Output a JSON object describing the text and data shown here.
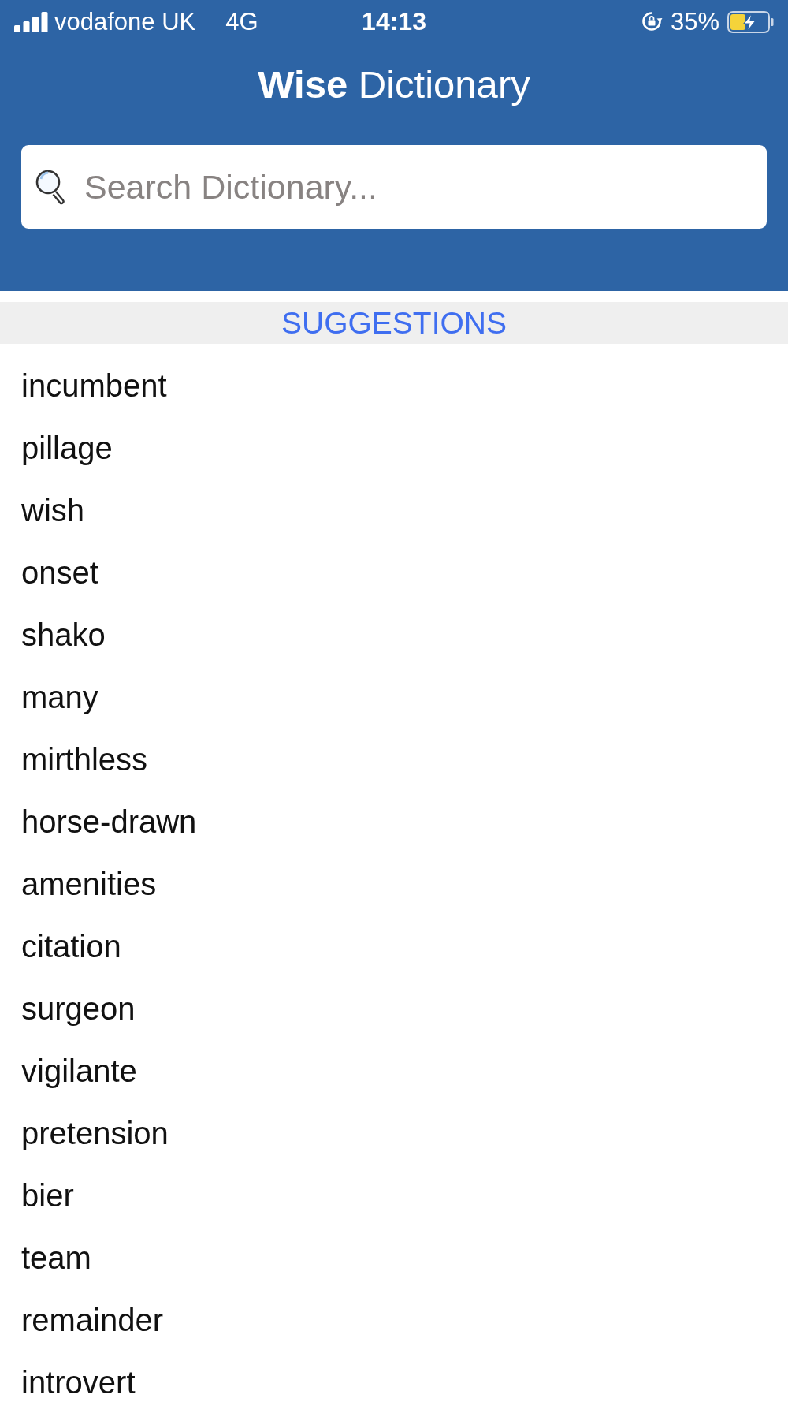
{
  "status_bar": {
    "carrier": "vodafone UK",
    "network": "4G",
    "time": "14:13",
    "battery_percent": "35%",
    "charging": true
  },
  "header": {
    "title": "**Wise** Dictionary"
  },
  "search": {
    "placeholder": "Search Dictionary..."
  },
  "suggestions": {
    "title": "SUGGESTIONS",
    "items": [
      "incumbent",
      "pillage",
      "wish",
      "onset",
      "shako",
      "many",
      "mirthless",
      "horse-drawn",
      "amenities",
      "citation",
      "surgeon",
      "vigilante",
      "pretension",
      "bier",
      "team",
      "remainder",
      "introvert"
    ]
  }
}
